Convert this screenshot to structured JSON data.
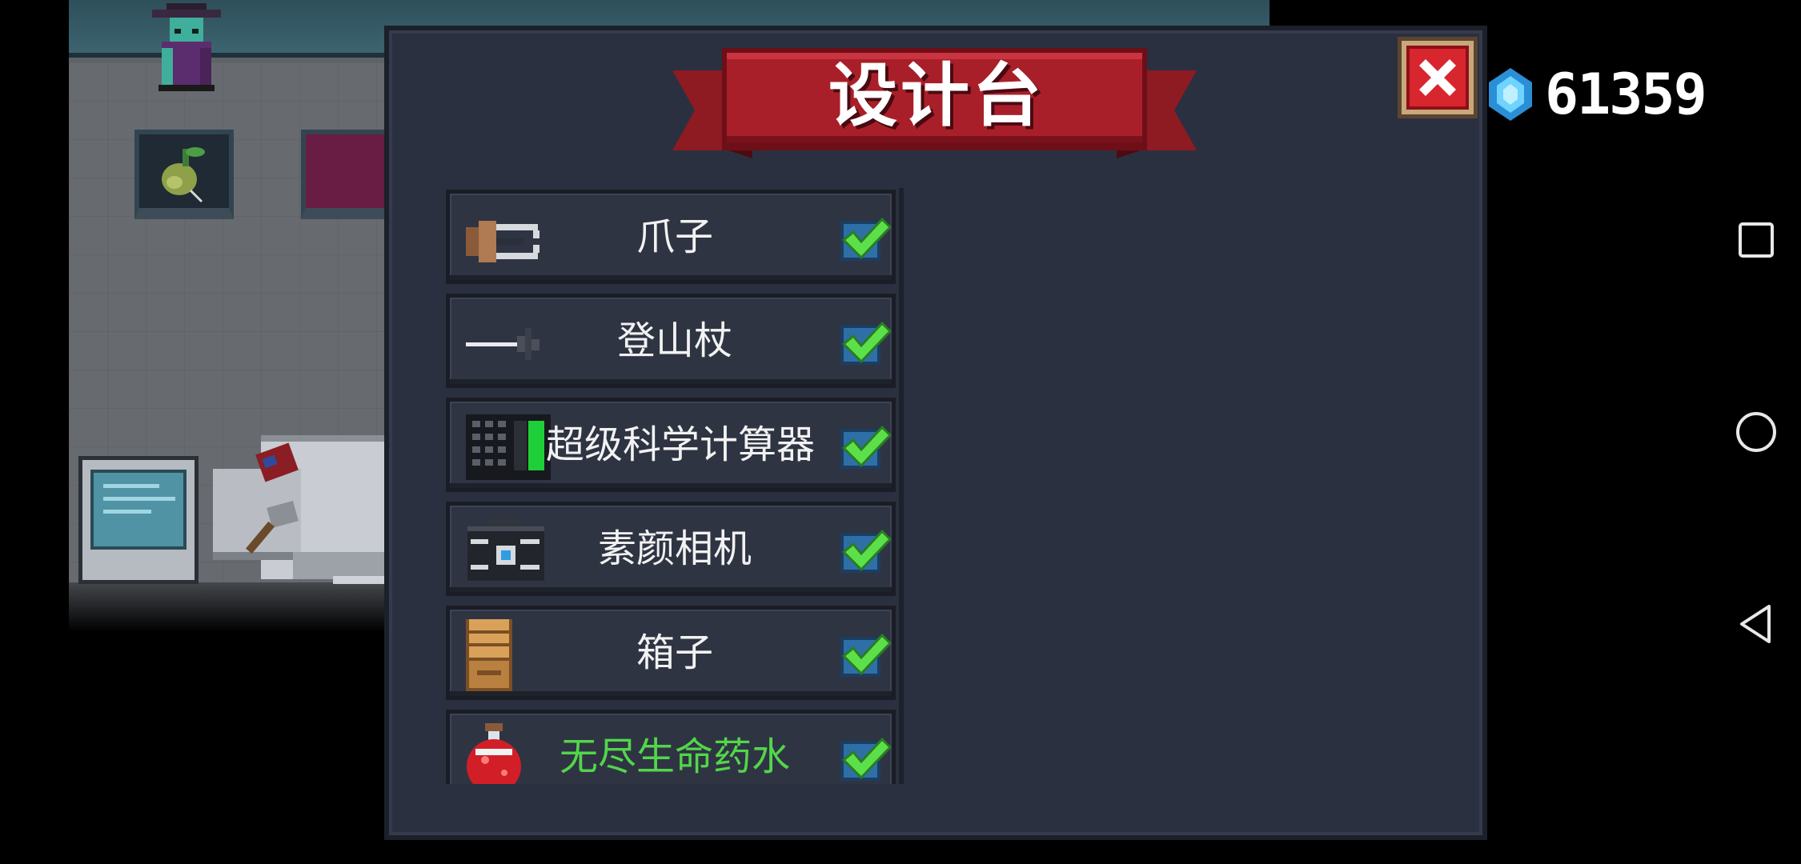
{
  "panel": {
    "title": "设计台"
  },
  "close_button": {
    "icon": "close-x-icon",
    "color": "#d8262e"
  },
  "currency": {
    "icon": "blue-gem-icon",
    "amount": "61359"
  },
  "items": [
    {
      "name": "爪子",
      "icon": "claw-icon",
      "checked": true,
      "color": "#f2f2f2"
    },
    {
      "name": "登山杖",
      "icon": "trekking-pole-icon",
      "checked": true,
      "color": "#f2f2f2"
    },
    {
      "name": "超级科学计算器",
      "icon": "calculator-icon",
      "checked": true,
      "color": "#f2f2f2"
    },
    {
      "name": "素颜相机",
      "icon": "camera-icon",
      "checked": true,
      "color": "#f2f2f2"
    },
    {
      "name": "箱子",
      "icon": "wooden-box-icon",
      "checked": true,
      "color": "#f2f2f2"
    },
    {
      "name": "无尽生命药水",
      "icon": "red-potion-icon",
      "checked": true,
      "color": "#52d64a"
    }
  ],
  "nav_bar": {
    "recents": "square-recents-icon",
    "home": "circle-home-icon",
    "back": "triangle-back-icon"
  }
}
